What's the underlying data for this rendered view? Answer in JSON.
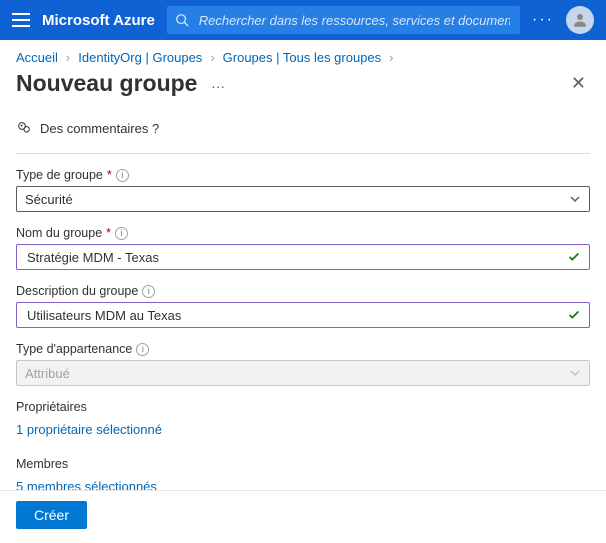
{
  "topbar": {
    "brand": "Microsoft Azure",
    "search_placeholder": "Rechercher dans les ressources, services et documents (G+/)"
  },
  "breadcrumbs": {
    "items": [
      "Accueil",
      "IdentityOrg | Groupes",
      "Groupes | Tous les groupes"
    ]
  },
  "page": {
    "title": "Nouveau groupe"
  },
  "feedback": {
    "label": "Des commentaires ?"
  },
  "labels": {
    "group_type": "Type de groupe",
    "group_name": "Nom du groupe",
    "group_desc": "Description du groupe",
    "membership_type": "Type d'appartenance",
    "owners": "Propriétaires",
    "members": "Membres"
  },
  "values": {
    "group_type": "Sécurité",
    "group_name": "Stratégie MDM - Texas",
    "group_desc": "Utilisateurs MDM au Texas",
    "membership_type": "Attribué"
  },
  "links": {
    "owners_selected": "1 propriétaire sélectionné",
    "members_selected": "5 membres sélectionnés"
  },
  "buttons": {
    "create": "Créer"
  }
}
